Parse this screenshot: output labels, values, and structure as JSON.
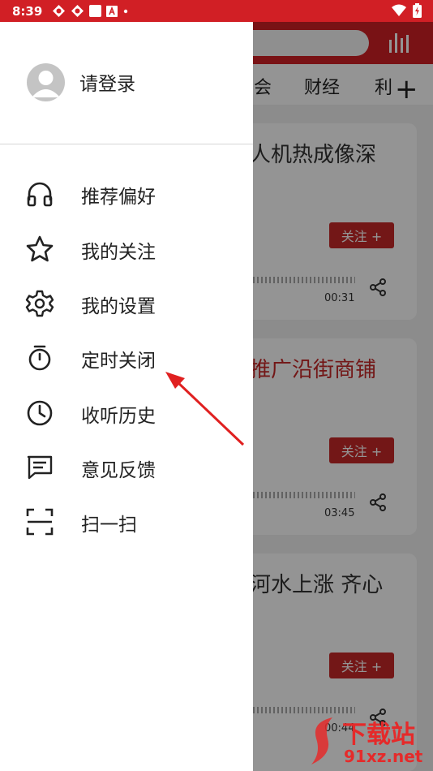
{
  "status_bar": {
    "time": "8:39"
  },
  "background": {
    "tabs": [
      "会",
      "财经",
      "利"
    ],
    "cards": [
      {
        "title": "人机热成像深",
        "follow_label": "关注 +",
        "duration": "00:31",
        "title_color": "#333333"
      },
      {
        "title": "推广沿街商铺",
        "follow_label": "关注 +",
        "duration": "03:45",
        "title_color": "#c62828"
      },
      {
        "title": "河水上涨 齐心",
        "follow_label": "关注 +",
        "duration": "00:44",
        "title_color": "#333333"
      }
    ]
  },
  "drawer": {
    "login_label": "请登录",
    "menu": [
      {
        "label": "推荐偏好",
        "icon": "headphones-icon"
      },
      {
        "label": "我的关注",
        "icon": "star-icon"
      },
      {
        "label": "我的设置",
        "icon": "gear-icon"
      },
      {
        "label": "定时关闭",
        "icon": "timer-icon"
      },
      {
        "label": "收听历史",
        "icon": "clock-icon"
      },
      {
        "label": "意见反馈",
        "icon": "feedback-icon"
      },
      {
        "label": "扫一扫",
        "icon": "scan-icon"
      }
    ]
  },
  "watermark": {
    "brand": "下载站",
    "url": "91xz.net"
  },
  "colors": {
    "accent": "#d11f25",
    "arrow": "#e02020"
  }
}
